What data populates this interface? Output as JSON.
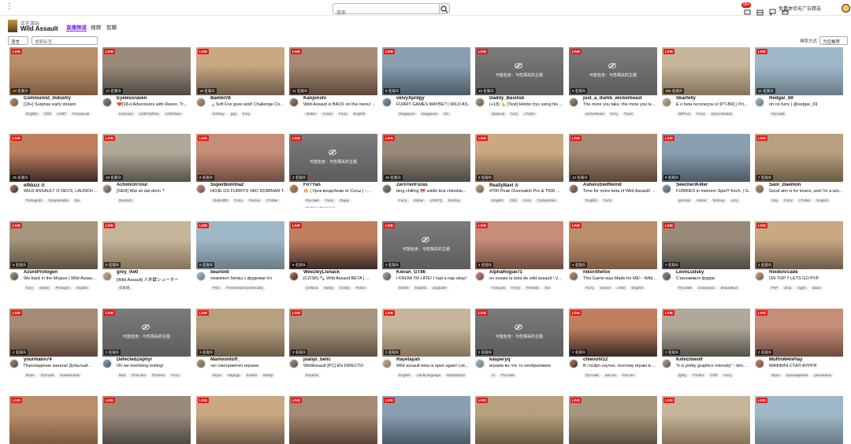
{
  "topbar": {
    "search_placeholder": "搜索",
    "badge_count": "99+",
    "promo": "免费体验无广告精选"
  },
  "header": {
    "sub": "正在游玩",
    "game": "Wild Assault",
    "tabs": [
      "直播频道",
      "视频",
      "剪辑"
    ]
  },
  "filters": {
    "language": "语言",
    "tag_placeholder": "搜索标签",
    "sort_label": "排序方式",
    "sort_value": "为您推荐"
  },
  "mature_text": "可能包含：与性相关的主题",
  "live_label": "LIVE",
  "colors": {
    "accent": "#772ce8",
    "live": "#e91916"
  },
  "cards": [
    {
      "name": "Communist_Industry",
      "title": "[18+] Surprise early stream",
      "viewers": "23 名观众",
      "tags": [
        "English",
        "Chill",
        "LGBT",
        "Pansexual"
      ],
      "mature": false
    },
    {
      "name": "Eyelessraven",
      "title": "❤️[18+] Adventures with Raven. Tr...",
      "viewers": "12 名观众",
      "tags": [
        "Inclusive",
        "LGBTQIPlus",
        "ChillVibes"
      ],
      "mature": false
    },
    {
      "name": "BambiV8",
      "title": "🍃Soft Fox goes wild! Challenge Co...",
      "viewers": "18 名观众",
      "tags": [
        "femboy",
        "gay",
        "furry"
      ],
      "mature": false
    },
    {
      "name": "Kanjonshi",
      "title": "Wild Assault is BACK on the menu! ...",
      "viewers": "11 名观众",
      "tags": [
        "Vtuber",
        "Anime",
        "Furry",
        "English"
      ],
      "mature": false
    },
    {
      "name": "velvyXprdgy",
      "title": "FURRY GAMES MAYBE? | WILD AS...",
      "viewers": "6 名观众",
      "tags": [
        "Singapore",
        "Singapura",
        "SG"
      ],
      "mature": false
    },
    {
      "name": "Daddy_Basilisk",
      "title": "(+18) 🐍 [Test] Himbo trys using his ...",
      "viewers": "15 名观众",
      "tags": [
        "dyslexia",
        "furry",
        "vTuber"
      ],
      "mature": true
    },
    {
      "name": "just_a_dumb_wickerbeast",
      "title": "The more you take, the more you le...",
      "viewers": "9 名观众",
      "tags": [
        "wickerbeast",
        "furry",
        "Trans"
      ],
      "mature": true
    },
    {
      "name": "Skartelly",
      "title": "É o beta reconeçou o/ [PT-BR] | Pri...",
      "viewers": "185 名观众",
      "tags": [
        "BRFurs",
        "Furry",
        "Descontraido"
      ],
      "mature": false
    },
    {
      "name": "Redgar_69",
      "title": "oh no furry | @redgar_69",
      "viewers": "41 名观众",
      "tags": [
        "Русский"
      ],
      "mature": false
    },
    {
      "name": "elfduzz ⊙",
      "title": "WILD ASSAULT /// DEVS, LAUNCH ...",
      "viewers": "25 名观众",
      "tags": [
        "Português",
        "Dropsenable",
        "fps"
      ],
      "mature": false
    },
    {
      "name": "AchimOnTour",
      "title": "[GER] Wat ist dat denn ?",
      "viewers": "18 名观众",
      "tags": [
        "Deutsch"
      ],
      "mature": false
    },
    {
      "name": "SuperBolinha2",
      "title": "HOJE OS FURRYS VAO DOMINAR T...",
      "viewers": "8 名观众",
      "tags": [
        "VtuberBR",
        "Furry",
        "Furries",
        "VTuber"
      ],
      "mature": false
    },
    {
      "name": "Fir7Yan",
      "title": "🔥 | Урок входобеки от Сосы | ~...",
      "viewers": "2 名观众",
      "tags": [
        "Русский",
        "Furry",
        "Ящик",
        "ЛюбимыйЧетчика"
      ],
      "mature": true
    },
    {
      "name": "ZeroTenFuras",
      "title": "bing chilling 🎀 wielki test chinskie...",
      "viewers": "15 名观众",
      "tags": [
        "Furry",
        "Vtuber",
        "LGBTQ",
        "femboy"
      ],
      "mature": false
    },
    {
      "name": "ReallyNavi ⊙",
      "title": "4700 Peak Overwatch Pro & T500 ...",
      "viewers": "6 名观众",
      "tags": [
        "English",
        "Chill",
        "Cozy",
        "Competitive"
      ],
      "mature": false
    },
    {
      "name": "AsheruSwiftwind",
      "title": "Time for more beta of Wild Assault! ...",
      "viewers": "12 名观众",
      "tags": [
        "English",
        "Furry"
      ],
      "mature": false
    },
    {
      "name": "SeecheriK4ter",
      "title": "FURRIES in meinem Spiel? frech. | G...",
      "viewers": "9 名观众",
      "tags": [
        "german",
        "vtuber",
        "femboy",
        "cozy"
      ],
      "mature": false
    },
    {
      "name": "Saor_Daemon",
      "title": "Good aim is for losers, and I'm a win...",
      "viewers": "7 名观众",
      "tags": [
        "Gay",
        "Furry",
        "VTuber",
        "English"
      ],
      "mature": false
    },
    {
      "name": "AzureProtogen",
      "title": "We back in the Mojave | Wild Assau...",
      "viewers": "6 名观众",
      "tags": [
        "furry",
        "vtuber",
        "Protogen",
        "English"
      ],
      "mature": false
    },
    {
      "name": "grey_0w0_",
      "title": "[Wild Assault] 人外獣シューター",
      "viewers": "6 名观众",
      "tags": [
        "日本語"
      ],
      "mature": false
    },
    {
      "name": "beartold",
      "title": "ломяіяют битвы с фуррями !гп",
      "viewers": "5 名观众",
      "tags": [
        "PSC",
        "FreeStreamCommunity"
      ],
      "mature": false
    },
    {
      "name": "WeezleyLishack",
      "title": "[CZ/SK] 🐾 Wild Assault BETA | ...",
      "viewers": "5 名观众",
      "tags": [
        "Čeština",
        "Tanky",
        "Český",
        "Pokec"
      ],
      "mature": false
    },
    {
      "name": "Kieran_GT86",
      "title": "I KNOW I'M LATE! I had a nap okay!",
      "viewers": "4 名观众",
      "tags": [
        "British",
        "English",
        "pngtuber"
      ],
      "mature": true
    },
    {
      "name": "AlphaRogue71",
      "title": "on essaie la beta de wild assault ! V...",
      "viewers": "4 名观众",
      "tags": [
        "Français",
        "Furry",
        "Friendly",
        "fun"
      ],
      "mature": false
    },
    {
      "name": "hikorithefox",
      "title": "This Game was Made for ME! - Wild...",
      "viewers": "4 名观众",
      "tags": [
        "Furry",
        "Gamer",
        "Artist",
        "English"
      ],
      "mature": false
    },
    {
      "name": "LeonLudsky",
      "title": "Становимся фурри",
      "viewers": "4 名观众",
      "tags": [
        "Русский",
        "плохиграс",
        "вежливые"
      ],
      "mature": false
    },
    {
      "name": "ReideArcade",
      "title": "ON TOP !! LETS GO PVP",
      "viewers": "3 名观众",
      "tags": [
        "PvP",
        "drop",
        "rxglis",
        "asian"
      ],
      "mature": false
    },
    {
      "name": "yourmann74",
      "title": "Пороождение канала! Добытый...",
      "viewers": "4 名观众",
      "tags": [
        "Игры",
        "Русский",
        "Хоккеетрим"
      ],
      "mature": false
    },
    {
      "name": "DefectedZephyr",
      "title": "Oh we kwehking testing!",
      "viewers": "3 名观众",
      "tags": [
        "Bird",
        "Chocobo",
        "Phoenix",
        "Furry"
      ],
      "mature": true
    },
    {
      "name": "Mamoontoff_",
      "title": "чет смотрим/чет играем",
      "viewers": "3 名观众",
      "tags": [
        "Игры",
        "Парадр",
        "Зомби",
        "Юмор"
      ],
      "mature": false
    },
    {
      "name": "juanjo_belic",
      "title": "WildAssault [PC] EN DIRECTO",
      "viewers": "3 名观众",
      "tags": [
        "Español"
      ],
      "mature": false
    },
    {
      "name": "Rayetayah",
      "title": "Wild assault beta is open again! Let...",
      "viewers": "2 名观众",
      "tags": [
        "English",
        "AdultLanguage",
        "adult18plus"
      ],
      "mature": false
    },
    {
      "name": "kasperyq",
      "title": "играем во что то необратимое",
      "viewers": "2 名观众",
      "tags": [
        "ru",
        "Русский"
      ],
      "mature": true
    },
    {
      "name": "chlenofil12",
      "title": "В гтаЗрп скучно, поэтому играю в ...",
      "viewers": "2 名观众",
      "tags": [
        "Русский",
        "жесткo",
        "Россия"
      ],
      "mature": false
    },
    {
      "name": "Kimichiwolf",
      "title": "\"it is pretty graphics intensity\" - kim...",
      "viewers": "2 名观众",
      "tags": [
        "lgbtq",
        "VTuber",
        "Chill",
        "Furry"
      ],
      "mature": false
    },
    {
      "name": "MuffinM4nPlay",
      "title": "МАФФИН СТАЛ ФУРРИ",
      "viewers": "2 名观众",
      "tags": [
        "Игры",
        "прохождение",
        "разговоры"
      ],
      "mature": false
    },
    {
      "name": "",
      "title": "",
      "viewers": "",
      "tags": [],
      "mature": false
    },
    {
      "name": "",
      "title": "",
      "viewers": "",
      "tags": [],
      "mature": false
    },
    {
      "name": "",
      "title": "",
      "viewers": "",
      "tags": [],
      "mature": false
    },
    {
      "name": "",
      "title": "",
      "viewers": "",
      "tags": [],
      "mature": false
    },
    {
      "name": "",
      "title": "",
      "viewers": "",
      "tags": [],
      "mature": false
    },
    {
      "name": "",
      "title": "",
      "viewers": "",
      "tags": [],
      "mature": false
    },
    {
      "name": "",
      "title": "",
      "viewers": "",
      "tags": [],
      "mature": false
    },
    {
      "name": "",
      "title": "",
      "viewers": "",
      "tags": [],
      "mature": false
    },
    {
      "name": "",
      "title": "",
      "viewers": "",
      "tags": [],
      "mature": false
    }
  ]
}
